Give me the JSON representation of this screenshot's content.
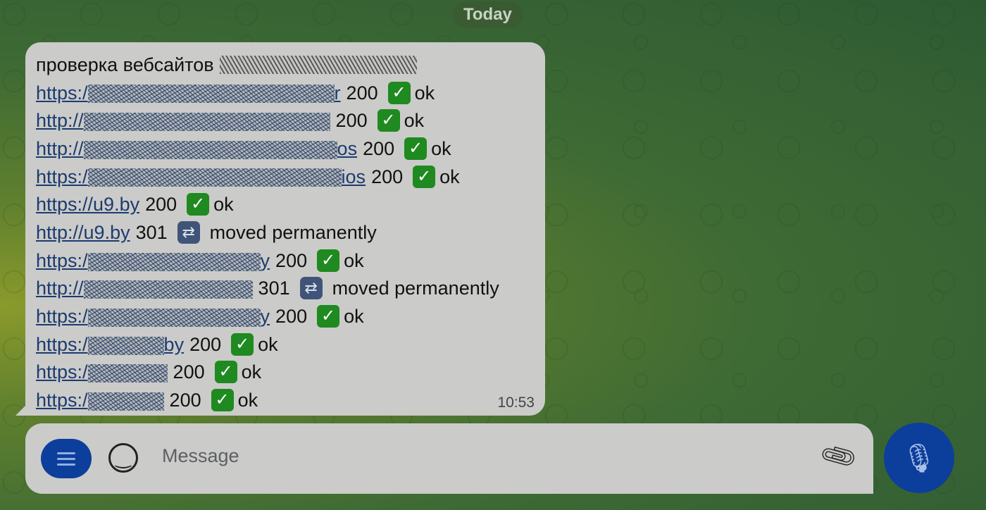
{
  "date_separator": "Today",
  "message": {
    "title": "проверка вебсайтов",
    "time": "10:53",
    "lines": [
      {
        "prefix": "https:/",
        "suffix": "r",
        "code": "200",
        "status": "ok",
        "icon": "check-mark-icon"
      },
      {
        "prefix": "http://",
        "suffix": "",
        "code": "200",
        "status": "ok",
        "icon": "check-mark-icon"
      },
      {
        "prefix": "http://",
        "suffix": "os",
        "code": "200",
        "status": "ok",
        "icon": "check-mark-icon"
      },
      {
        "prefix": "https:/",
        "suffix": "ios",
        "code": "200",
        "status": "ok",
        "icon": "check-mark-icon"
      },
      {
        "prefix": "https://u9.by",
        "suffix": "",
        "code": "200",
        "status": "ok",
        "icon": "check-mark-icon"
      },
      {
        "prefix": "http://u9.by",
        "suffix": "",
        "code": "301",
        "status": "moved permanently",
        "icon": "repeat-icon"
      },
      {
        "prefix": "https:/",
        "suffix": "y",
        "code": "200",
        "status": "ok",
        "icon": "check-mark-icon"
      },
      {
        "prefix": "http://",
        "suffix": "",
        "code": "301",
        "status": "moved permanently",
        "icon": "repeat-icon"
      },
      {
        "prefix": "https:/",
        "suffix": "y",
        "code": "200",
        "status": "ok",
        "icon": "check-mark-icon"
      },
      {
        "prefix": "https:/",
        "suffix": "by",
        "code": "200",
        "status": "ok",
        "icon": "check-mark-icon"
      },
      {
        "prefix": "https:/",
        "suffix": "",
        "code": "200",
        "status": "ok",
        "icon": "check-mark-icon"
      },
      {
        "prefix": "https:/",
        "suffix": "",
        "code": "200",
        "status": "ok",
        "icon": "check-mark-icon"
      }
    ]
  },
  "composer": {
    "placeholder": "Message"
  },
  "colors": {
    "accent": "#0c3e9c",
    "ok": "#1f8a1f",
    "link": "#1c3b70"
  }
}
